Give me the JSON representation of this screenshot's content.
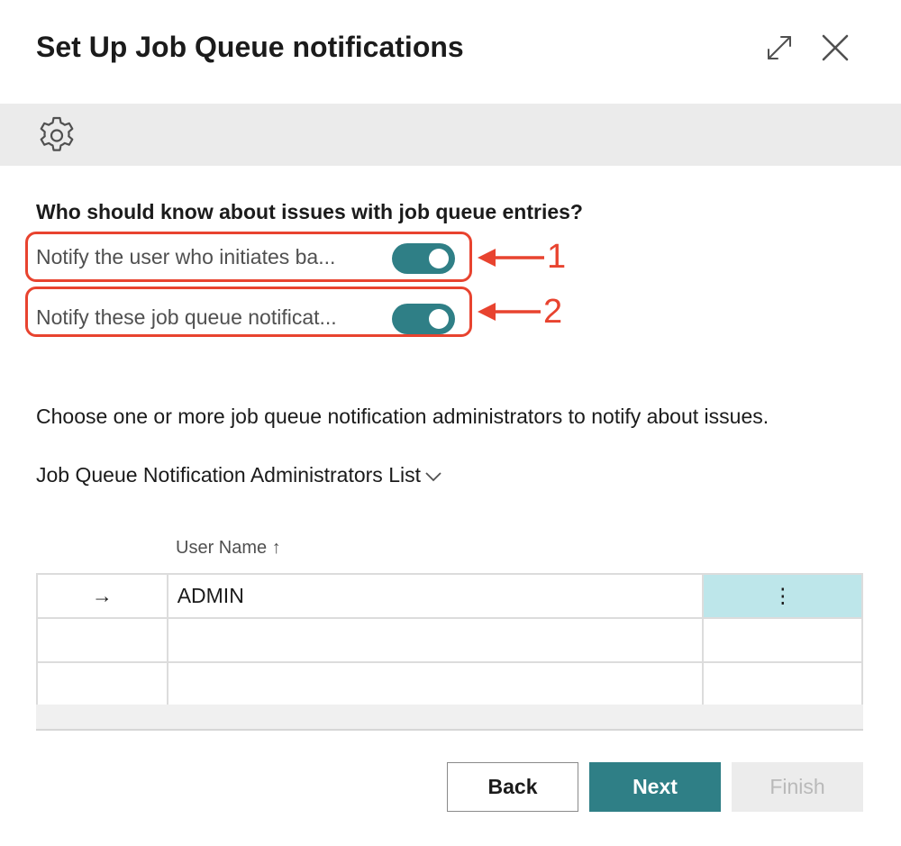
{
  "dialog": {
    "title": "Set Up Job Queue notifications",
    "expand_icon": "expand-icon",
    "close_icon": "close-icon"
  },
  "toolbar": {
    "icon": "gear-icon"
  },
  "question": "Who should know about issues with job queue entries?",
  "options": [
    {
      "label": "Notify the user who initiates ba...",
      "enabled": true
    },
    {
      "label": "Notify these job queue notificat...",
      "enabled": true
    }
  ],
  "annotations": [
    "1",
    "2"
  ],
  "description": "Choose one or more job queue notification administrators to notify about issues.",
  "list": {
    "title": "Job Queue Notification Administrators List",
    "column_header": "User Name",
    "sort_indicator": "↑",
    "rows": [
      {
        "marker": "→",
        "user_name": "ADMIN",
        "actions": "⋮"
      },
      {
        "marker": "",
        "user_name": "",
        "actions": ""
      },
      {
        "marker": "",
        "user_name": "",
        "actions": ""
      }
    ]
  },
  "buttons": {
    "back": "Back",
    "next": "Next",
    "finish": "Finish"
  },
  "colors": {
    "accent": "#2f7f86",
    "annotation": "#e8432f",
    "selected_cell": "#bde6ea"
  }
}
